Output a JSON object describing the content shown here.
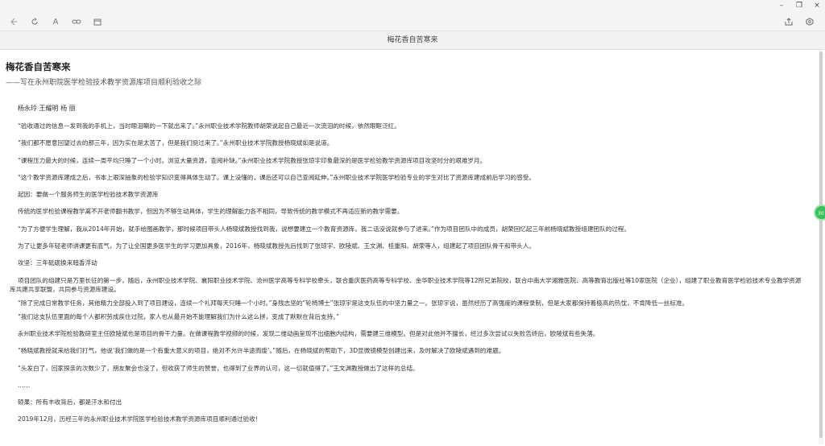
{
  "window_controls": {
    "minimize": "–",
    "restore": "❐",
    "close": "×"
  },
  "toolbar": {
    "back_icon": "arrow-left-icon",
    "refresh_icon": "refresh-icon",
    "font_label": "A",
    "link_icon": "link-icon",
    "calendar_icon": "calendar-icon",
    "share_icon": "share-icon",
    "settings_icon": "hexagon-settings-icon"
  },
  "window_title": "梅花香自苦寒来",
  "article": {
    "title": "梅花香自苦寒来",
    "subtitle": "——写在永州职院医学检验技术教学资源库项目顺利验收之际",
    "authors": "杨永玲  王耀明  杨 丽",
    "paragraphs": [
      "“验收通过的信息一发到我的手机上，当时眼泪唰的一下就出来了。”永州职业技术学院教师胡荣说起自己最近一次流泪的时候，依然眼眶泛红。",
      "“我们都不愿意回望过去的那三年，因为实在是太苦了，但是我们挺过来了。”永州职业技术学院教授杨晓斌如是说道。",
      "“课程压力最大的时候，连续一周平均只睡了一个小时。浏览大量资源，查阅补缺。”永州职业技术学院教授张琼宇印象最深的是医学检验教学资源库项目攻坚时分的艰难岁月。",
      "“这个教学资源库建成之后，书本上艰深抽象的检验学知识变得具体生动了。课上没懂的，课后还可以自己查阅延伸。”永州职业技术学院医学检验专业的学生对比了资源库建成前后学习的感受。",
      "起因：要做一个服务师生的医学检验技术教学资源库",
      "传统的医学检验课程教学离不开老师翻书教学，但因为不够生动具体，学生的理解能力各不相同，导致传统的教学模式不再适应新的教学需要。",
      "“为了方便学生理解，我从2014年开始，就手绘图画教学，那时候项目带头人杨晓斌教授找到我，说想要建立一个教育资源库，我二话没说就参与了进来。”作为项目团队中的成员，胡荣回忆起三年前杨晓斌教授组建团队的过程。",
      "为了让更多年轻老师讲课更有底气，为了让全国更多医学生的学习更加具象，2016年，杨晓斌教授先后找到了张琼宇、欧陵斌、王文渊、桂重阳、胡荣等人，组建起了项目团队骨干和带头人。",
      "攻坚：三年砥砺换来暗香浮动",
      "项目团队的组建只是万里长征的第一步，随后，永州职业技术学院、襄阳职业技术学院、沧州医学高等专科学校牵头，联合重庆医药高等专科学校、金华职业技术学院等12所兄弟院校，联合中南大学湘雅医院、高等教育出版社等10家医院（企业），组建了职业教育医学检验技术专业教学资源库共建共享联盟，共同参与资源库建设。",
      "“除了完成日常教学任务，其他精力全部投入到了项目建设，连续一个礼拜每天只睡一个小时。”身残志坚的“轮椅博士”张琼宇是这支队伍的中坚力量之一。张琼宇说，虽然经历了高强度的课程录制，但是大家都保持着极高的热忱，不肯降低一丝标准。",
      "“我们这支队伍里面的每个人都积劳成疾住过院，家人也从最开始不能理解我们为什么这么拼，变成了默默在背后支持。”",
      "永州职业技术学院检验教研室主任欧陵斌也是项目的骨干力量。在做课程教学视频的时候，发现二维动画呈现不出细胞内结构，需要建三维模型。但是对此他并不擅长，经过多次尝试以失败告终后，欧陵斌有些失落。",
      "“杨晓斌教授就来给我们打气，他说‘我们做的是一个有重大意义的项目，绝对不允许半途而废’。”随后，在杨晓斌的帮助下，3D显微镜模型创建出来，及时解决了欧陵斌遇到的难题。",
      "“头发白了，回家探亲的次数少了，朋友聚会也没了，但收获了师生的赞誉，也得到了业界的认可，这一切就值得了。”王文渊教授做出了这样的总结。",
      "……",
      "硕果：所有丰收背后，都是汗水和付出",
      "2019年12月，历经三年的永州职业技术学院医学检验技术教学资源库项目顺利通过验收！"
    ]
  },
  "float_badge": "30",
  "colors": {
    "topbar_bg": "#f4f4f4",
    "titlebar_bg": "#f2f2f2",
    "text": "#333333",
    "badge": "#3bbf5a"
  }
}
